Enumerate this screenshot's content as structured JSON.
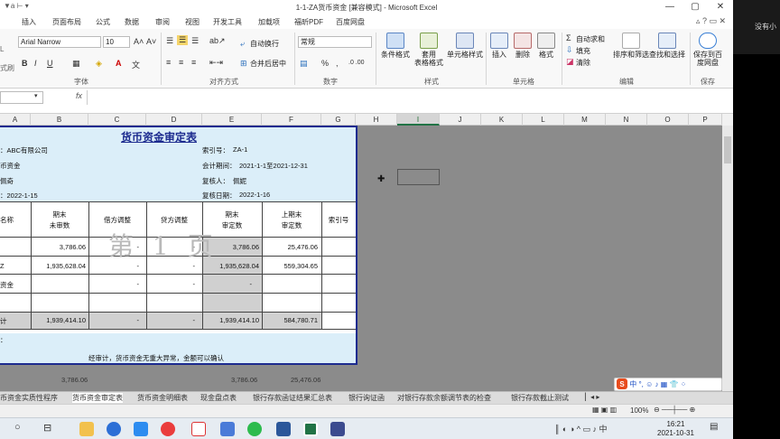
{
  "window": {
    "title": "1-1-ZA货币资金 [兼容模式] - Microsoft Excel",
    "qa_left": "▼a ⊢ ▾",
    "ctrl_min": "—",
    "ctrl_max": "▢",
    "ctrl_close": "✕",
    "tab_icons": "▵ ? ▭ ✕"
  },
  "right_strip": {
    "text": "没有小"
  },
  "tabs": [
    "插入",
    "页面布局",
    "公式",
    "数据",
    "审阅",
    "视图",
    "开发工具",
    "加载项",
    "福昕PDF",
    "百度网盘"
  ],
  "ribbon": {
    "font_name": "Arial Narrow",
    "font_size": "10",
    "font_grow": "A˄",
    "font_shrink": "A˅",
    "bold": "B",
    "italic": "I",
    "underline": "U",
    "left_tip_1": "L",
    "left_tip_2": "式刷",
    "wrap_text": "自动换行",
    "merge_center": "合并后居中",
    "number_format": "常规",
    "percent": "%",
    "comma": ",",
    "group_font": "字体",
    "group_align": "对齐方式",
    "group_number": "数字",
    "group_styles": "样式",
    "group_cells": "单元格",
    "group_edit": "编辑",
    "group_save": "保存",
    "cond_format": "条件格式",
    "table_format_1": "套用",
    "table_format_2": "表格格式",
    "cell_style": "单元格样式",
    "insert": "插入",
    "delete": "删除",
    "format": "格式",
    "autosum": "自动求和",
    "fill": "填充",
    "clear": "清除",
    "sort_filter": "排序和筛选",
    "find_select": "查找和选择",
    "save_baidu_1": "保存到百",
    "save_baidu_2": "度网盘"
  },
  "formula_bar": {
    "fx": "fx",
    "value": ""
  },
  "columns": [
    "A",
    "B",
    "C",
    "D",
    "E",
    "F",
    "G",
    "H",
    "I",
    "J",
    "K",
    "L",
    "M",
    "N",
    "O",
    "P"
  ],
  "selected_column": "I",
  "report": {
    "title": "货币资金审定表",
    "company": "：ABC有限公司",
    "item": "币资金",
    "preparer": "佩奇",
    "prep_date": "：2022-1-15",
    "index_label": "索引号：",
    "index_value": "ZA-1",
    "period_label": "会计期间：",
    "period_value": "2021-1-1至2021-12-31",
    "reviewer_label": "复核人：",
    "reviewer_value": "佩妮",
    "review_date_label": "复核日期：",
    "review_date_value": "2022-1-16",
    "headers": {
      "name": "名称",
      "unaudited_1": "期末",
      "unaudited_2": "未审数",
      "debit_adj": "借方调整",
      "credit_adj": "贷方调整",
      "audited_1": "期末",
      "audited_2": "审定数",
      "prior_1": "上期末",
      "prior_2": "审定数",
      "index": "索引号"
    },
    "rows": [
      {
        "name": "",
        "unaudited": "3,786.06",
        "debit": "-",
        "credit": "-",
        "audited": "3,786.06",
        "prior": "25,476.06"
      },
      {
        "name": "Z",
        "unaudited": "1,935,628.04",
        "debit": "-",
        "credit": "-",
        "audited": "1,935,628.04",
        "prior": "559,304.65"
      },
      {
        "name": "资金",
        "unaudited": "",
        "debit": "-",
        "credit": "-",
        "audited": "-",
        "prior": ""
      },
      {
        "name": "",
        "unaudited": "",
        "debit": "",
        "credit": "",
        "audited": "",
        "prior": ""
      },
      {
        "name": "计",
        "unaudited": "1,939,414.10",
        "debit": "-",
        "credit": "-",
        "audited": "1,939,414.10",
        "prior": "584,780.71"
      }
    ],
    "note_label": "：",
    "conclusion": "经审计，货币资金无重大异常，金额可以确认",
    "watermark": "第 1 页"
  },
  "below_values": [
    "3,786.06",
    "3,786.06",
    "25,476.06"
  ],
  "sheet_tabs": [
    "币资金实质性程序",
    "货币资金审定表",
    "货币资金明细表",
    "现金盘点表",
    "银行存款函证结果汇总表",
    "银行询证函",
    "对银行存款余额调节表的检查",
    "银行存款截止测试"
  ],
  "active_sheet": "货币资金审定表",
  "status": {
    "zoom": "100%"
  },
  "ime": {
    "logo": "S",
    "text": "中 °,  ☺ ♪ ▦ 👕 ⁘"
  },
  "clock": {
    "time": "16:21",
    "date": "2021-10-31"
  }
}
